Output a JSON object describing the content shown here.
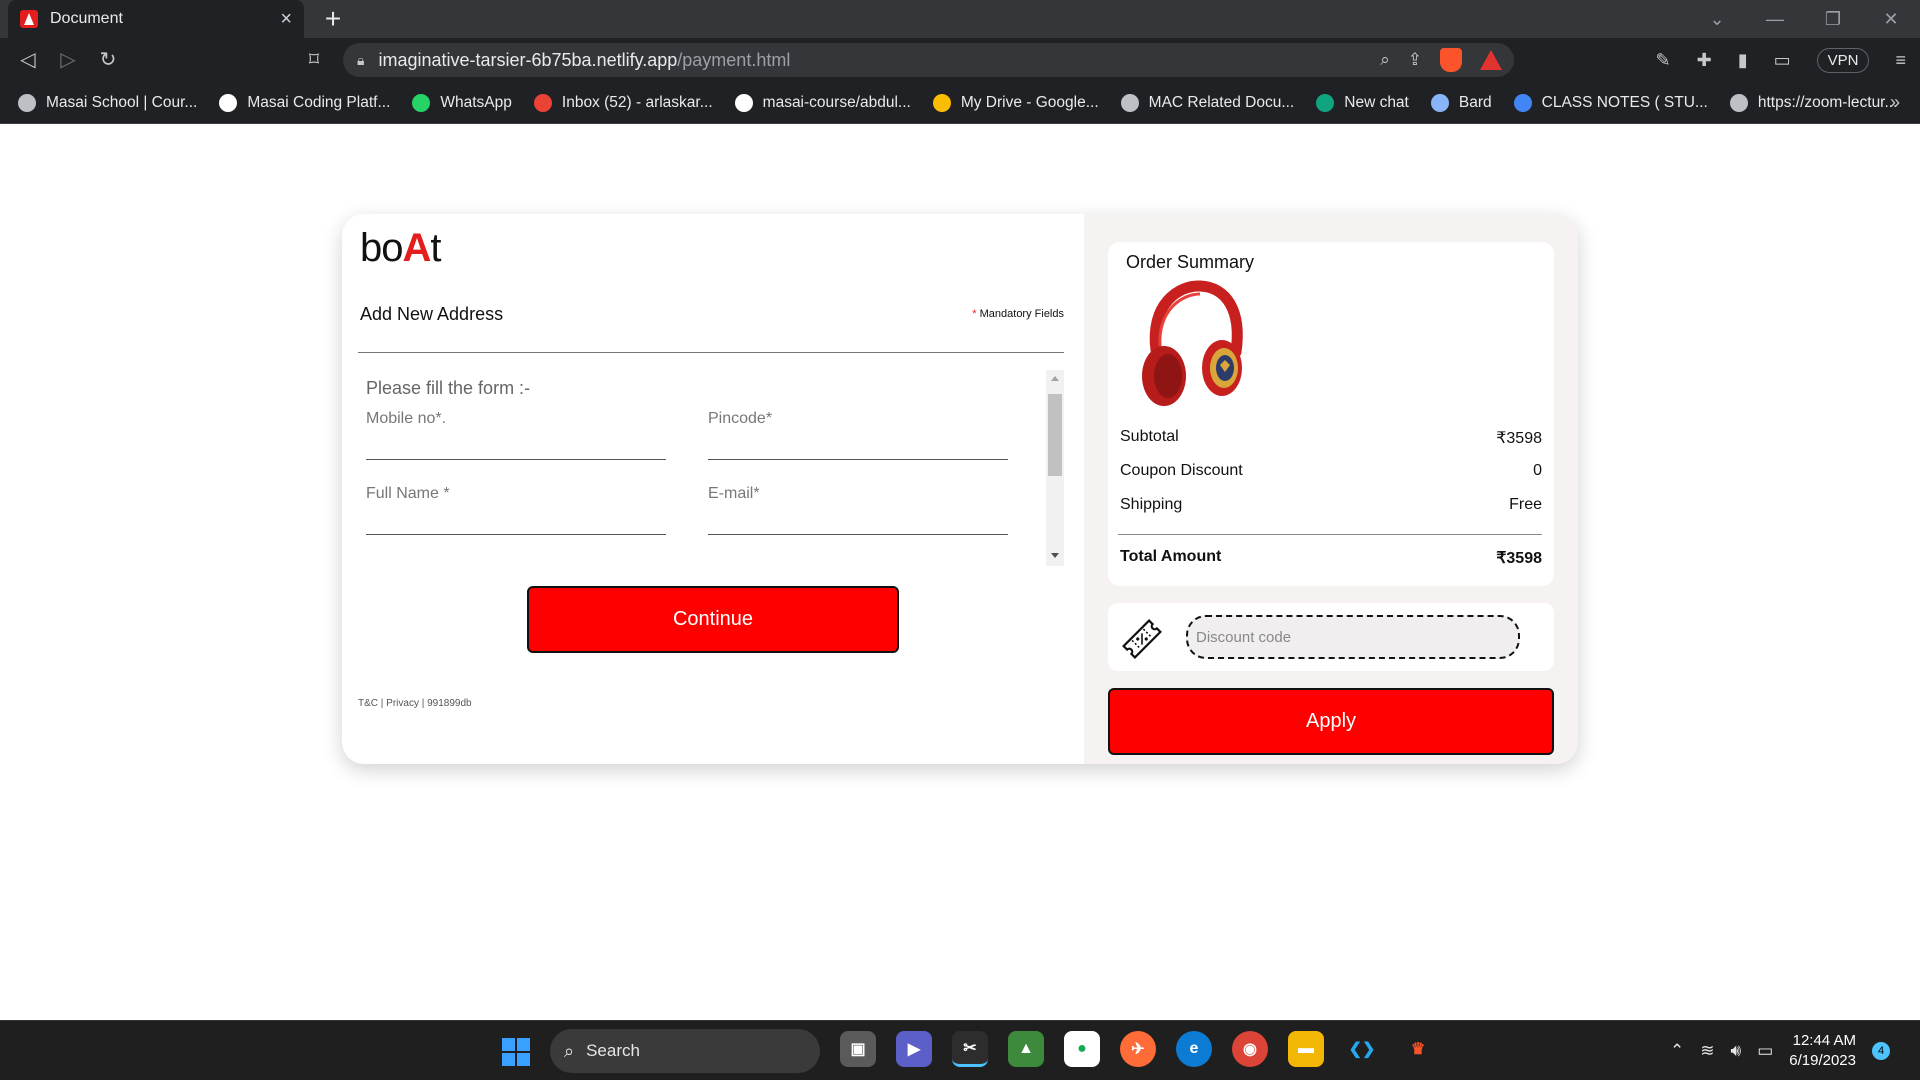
{
  "browser": {
    "tab_title": "Document",
    "url_host": "imaginative-tarsier-6b75ba.netlify.app",
    "url_path": "/payment.html",
    "vpn_label": "VPN",
    "bookmarks": [
      {
        "label": "Masai School | Cour...",
        "icon": "globe-icon",
        "color": "#bdc1c6"
      },
      {
        "label": "Masai Coding Platf...",
        "icon": "masai-icon",
        "color": "#ffffff"
      },
      {
        "label": "WhatsApp",
        "icon": "whatsapp-icon",
        "color": "#25d366"
      },
      {
        "label": "Inbox (52) - arlaskar...",
        "icon": "gmail-icon",
        "color": "#ea4335"
      },
      {
        "label": "masai-course/abdul...",
        "icon": "github-icon",
        "color": "#ffffff"
      },
      {
        "label": "My Drive - Google...",
        "icon": "drive-icon",
        "color": "#fbbc04"
      },
      {
        "label": "MAC Related Docu...",
        "icon": "globe-icon",
        "color": "#bdc1c6"
      },
      {
        "label": "New chat",
        "icon": "chatgpt-icon",
        "color": "#10a37f"
      },
      {
        "label": "Bard",
        "icon": "bard-icon",
        "color": "#8ab4f8"
      },
      {
        "label": "CLASS NOTES ( STU...",
        "icon": "notes-icon",
        "color": "#4285f4"
      },
      {
        "label": "https://zoom-lectur...",
        "icon": "globe-icon",
        "color": "#bdc1c6"
      }
    ]
  },
  "left": {
    "logo_pre": "bo",
    "logo_a": "A",
    "logo_post": "t",
    "address_title": "Add New Address",
    "mandatory_star": "*",
    "mandatory_text": "Mandatory Fields",
    "form_heading": "Please fill the form :-",
    "fields": {
      "mobile": "Mobile no*.",
      "pincode": "Pincode*",
      "full_name": "Full Name *",
      "email": "E-mail*"
    },
    "continue_label": "Continue",
    "footer": "T&C | Privacy | 991899db"
  },
  "summary": {
    "title": "Order Summary",
    "subtotal_label": "Subtotal",
    "subtotal_value": "₹3598",
    "coupon_label": "Coupon Discount",
    "coupon_value": "0",
    "shipping_label": "Shipping",
    "shipping_value": "Free",
    "total_label": "Total Amount",
    "total_value": "₹3598",
    "discount_placeholder": "Discount code",
    "apply_label": "Apply"
  },
  "taskbar": {
    "search_label": "Search",
    "time": "12:44 AM",
    "date": "6/19/2023",
    "notification_count": "4"
  },
  "colors": {
    "accent": "#ff0000",
    "brand_red": "#e41d1d"
  }
}
